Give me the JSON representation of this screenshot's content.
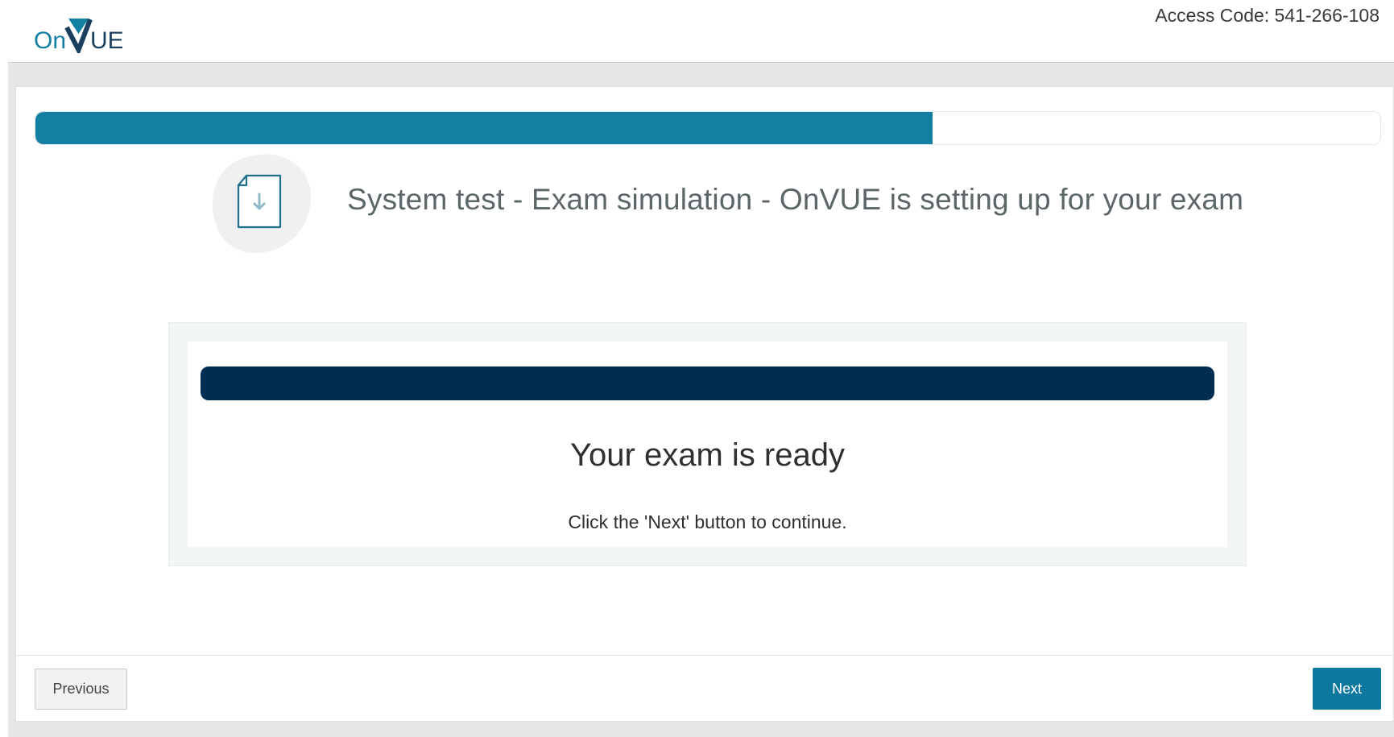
{
  "header": {
    "logo_text": "OnVUE",
    "access_code": "Access Code: 541-266-108"
  },
  "progress": {
    "fraction": 0.667,
    "fill_color": "#127fa3"
  },
  "step": {
    "icon": "file-download-icon",
    "title": "System test - Exam simulation - OnVUE is setting up for your exam"
  },
  "status": {
    "bar_color": "#002d52",
    "title": "Your exam is ready",
    "message": "Click the 'Next' button to continue."
  },
  "footer": {
    "previous_label": "Previous",
    "next_label": "Next"
  },
  "colors": {
    "brand_teal": "#127fa3",
    "brand_navy": "#1b3f5e",
    "next_button": "#0c789e"
  }
}
